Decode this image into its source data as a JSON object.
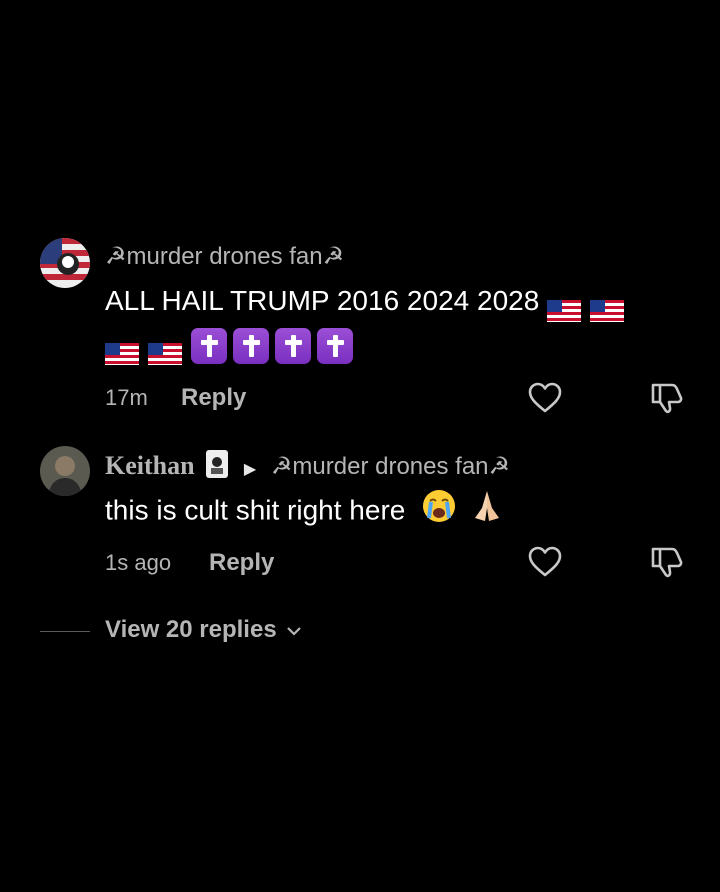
{
  "comments": [
    {
      "username_prefix": "☭",
      "username": "murder drones fan",
      "username_suffix": "☭",
      "text_line1": "ALL HAIL TRUMP 2016 2024 2028",
      "time": "17m",
      "reply_label": "Reply",
      "icons": [
        "us-flag",
        "us-flag",
        "us-flag",
        "us-flag",
        "latin-cross",
        "latin-cross",
        "latin-cross",
        "latin-cross"
      ]
    },
    {
      "username": "Keithan",
      "reply_to_prefix": "☭",
      "reply_to": "murder drones fan",
      "reply_to_suffix": "☭",
      "text": "this is cult shit right here",
      "time": "1s ago",
      "reply_label": "Reply",
      "icons": [
        "loudly-crying-face",
        "folded-hands"
      ]
    }
  ],
  "view_replies": "View 20 replies",
  "accent": "#9b4fd6"
}
